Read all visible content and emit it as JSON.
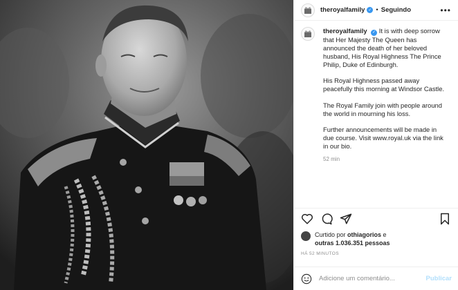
{
  "post": {
    "username": "theroyalfamily",
    "separator": "•",
    "follow_label": "Seguindo",
    "more_label": "•••",
    "caption_paragraphs": [
      "It is with deep sorrow that Her Majesty The Queen has announced the death of her beloved husband, His Royal Highness The Prince Philip, Duke of Edinburgh.",
      "His Royal Highness passed away peacefully this morning at Windsor Castle.",
      "The Royal Family join with people around the world in mourning his loss.",
      "Further announcements will be made in due course. Visit www.royal.uk via the link in our bio."
    ],
    "caption_time": "52 min",
    "liked_prefix": "Curtido por ",
    "liked_by": "othiagorios",
    "liked_mid": " e",
    "liked_others": "outras 1.036.351 pessoas",
    "posted_ago": "HÁ 52 MINUTOS",
    "comment_placeholder": "Adicione um comentário...",
    "publish_label": "Publicar"
  },
  "icons": {
    "like": "heart-icon",
    "comment": "comment-icon",
    "share": "share-icon",
    "save": "bookmark-icon",
    "emoji": "emoji-icon",
    "verified": "verified-badge-icon"
  },
  "colors": {
    "verified": "#3897f0",
    "publish_disabled": "#b2dffc",
    "secondary_text": "#8e8e8e"
  }
}
